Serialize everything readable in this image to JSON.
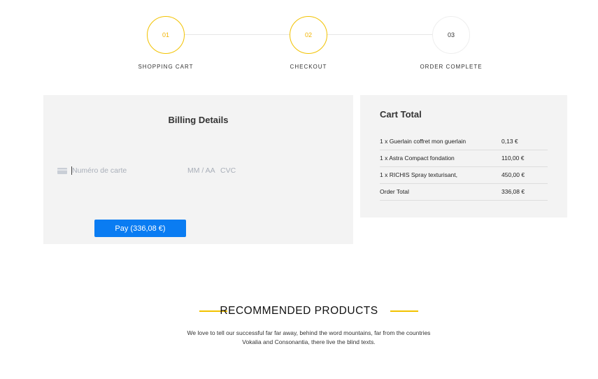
{
  "steps": [
    {
      "number": "01",
      "label": "SHOPPING CART",
      "state": "active"
    },
    {
      "number": "02",
      "label": "CHECKOUT",
      "state": "active"
    },
    {
      "number": "03",
      "label": "ORDER COMPLETE",
      "state": "inactive"
    }
  ],
  "billing": {
    "title": "Billing Details",
    "card_number_placeholder": "Numéro de carte",
    "expiry_placeholder": "MM / AA",
    "cvc_placeholder": "CVC",
    "pay_label": "Pay (336,08 €)"
  },
  "cart": {
    "title": "Cart Total",
    "rows": [
      {
        "name": "1 x Guerlain coffret mon guerlain",
        "price": "0,13 €"
      },
      {
        "name": "1 x Astra Compact fondation",
        "price": "110,00 €"
      },
      {
        "name": "1 x RICHIS Spray texturisant,",
        "price": "450,00 €"
      },
      {
        "name": "Order Total",
        "price": "336,08 €"
      }
    ]
  },
  "recommended": {
    "title": "RECOMMENDED PRODUCTS",
    "text": "We love to tell our successful far far away, behind the word mountains, far from the countries Vokalia and Consonantia, there live the blind texts."
  },
  "colors": {
    "accent_yellow": "#f2c200",
    "pay_blue": "#0a7cf2",
    "panel_gray": "#f3f3f3"
  }
}
